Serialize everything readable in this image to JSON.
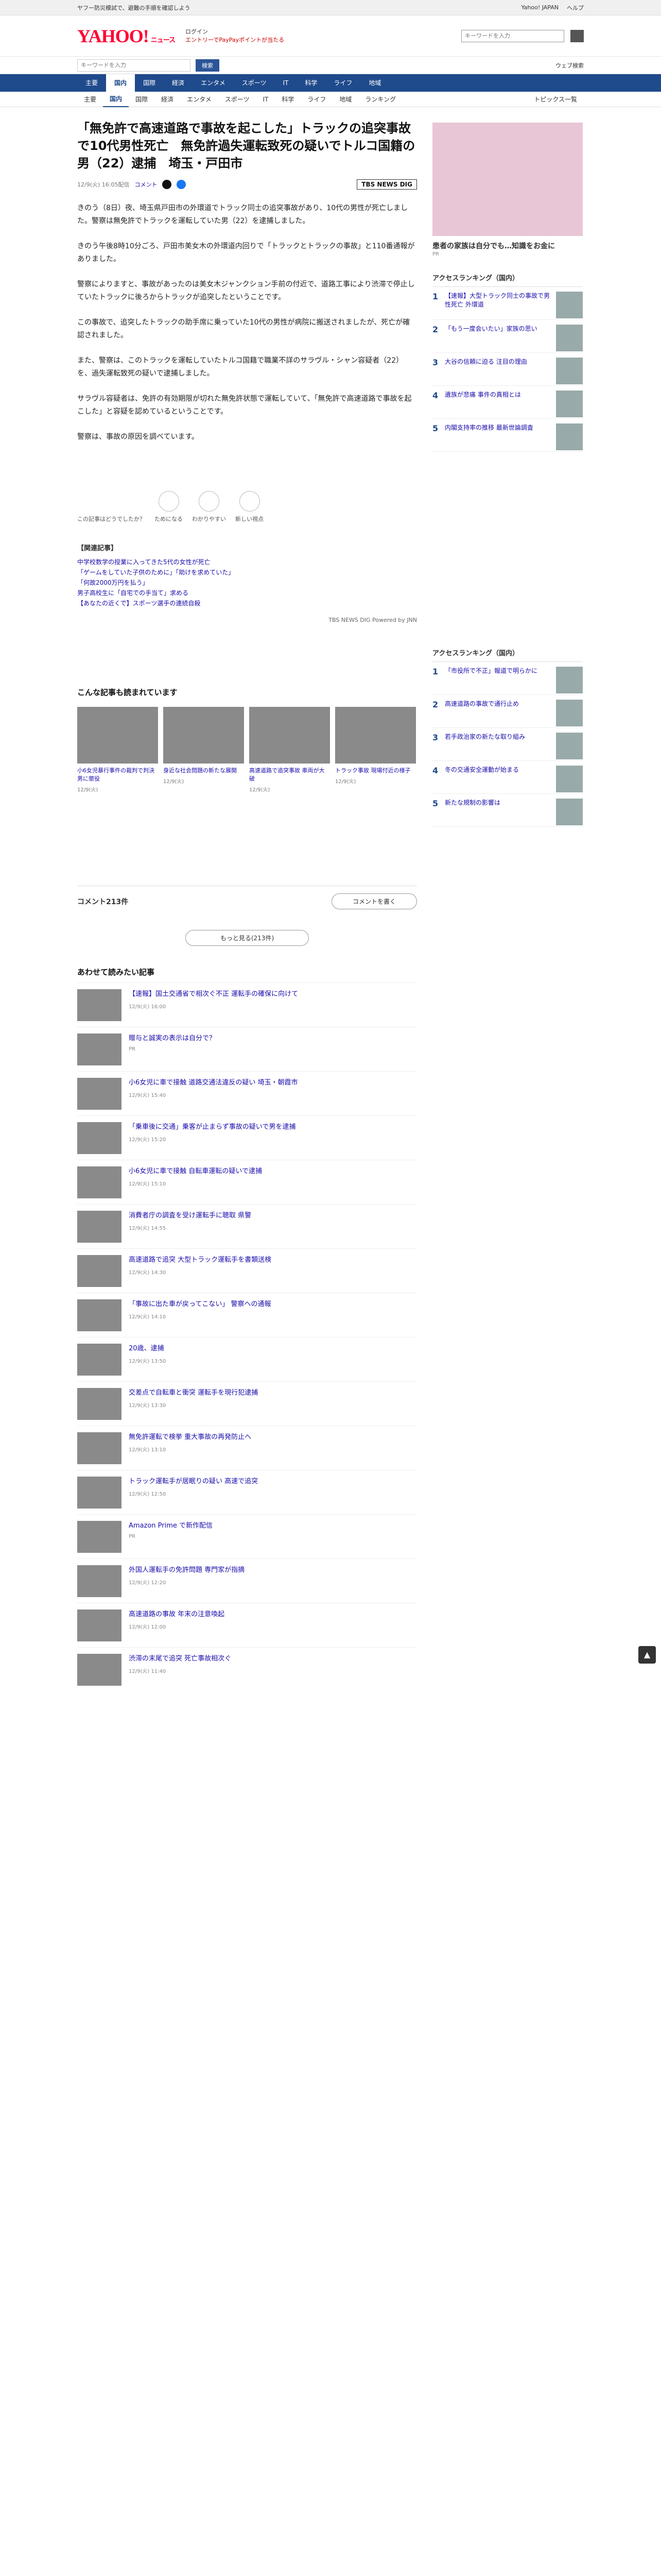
{
  "topbar": {
    "left": "ヤフー防災模試で、避難の手順を確認しよう",
    "mid": "ログイン",
    "links": [
      "Yahoo! JAPAN",
      "ヘルプ"
    ]
  },
  "header": {
    "logo": "YAHOO!",
    "logo_sub": "ニュース",
    "account": "ログイン",
    "promo": "エントリーでPayPayポイントが当たる",
    "search_placeholder": "キーワードを入力"
  },
  "subbar": {
    "search_placeholder": "キーワードを入力",
    "btn1": "検索",
    "btn2": "ウェブ検索"
  },
  "nav": [
    "主要",
    "国内",
    "国際",
    "経済",
    "エンタメ",
    "スポーツ",
    "IT",
    "科学",
    "ライフ",
    "地域"
  ],
  "nav_active": "国内",
  "nav2": [
    "主要",
    "国内",
    "国際",
    "経済",
    "エンタメ",
    "スポーツ",
    "IT",
    "科学",
    "ライフ",
    "地域",
    "ランキング"
  ],
  "nav2_active": "国内",
  "nav2_right": "トピックス一覧",
  "article": {
    "title": "「無免許で高速道路で事故を起こした」トラックの追突事故で10代男性死亡　無免許過失運転致死の疑いでトルコ国籍の男（22）逮捕　埼玉・戸田市",
    "date": "12/9(火) 16:05配信",
    "comments_label": "コメント",
    "source": "TBS NEWS DIG",
    "paragraphs": [
      "きのう（8日）夜、埼玉県戸田市の外環道でトラック同士の追突事故があり、10代の男性が死亡しました。警察は無免許でトラックを運転していた男（22）を逮捕しました。",
      "きのう午後8時10分ごろ、戸田市美女木の外環道内回りで「トラックとトラックの事故」と110番通報がありました。",
      "警察によりますと、事故があったのは美女木ジャンクション手前の付近で、道路工事により渋滞で停止していたトラックに後ろからトラックが追突したということです。",
      "この事故で、追突したトラックの助手席に乗っていた10代の男性が病院に搬送されましたが、死亡が確認されました。",
      "また、警察は、このトラックを運転していたトルコ国籍で職業不詳のサラヴル・シャン容疑者（22）を、過失運転致死の疑いで逮捕しました。",
      "サラヴル容疑者は、免許の有効期限が切れた無免許状態で運転していて、「無免許で高速道路で事故を起こした」と容疑を認めているということです。",
      "警察は、事故の原因を調べています。"
    ],
    "reactions_label": "この記事はどうでしたか？",
    "reactions": [
      "ためになる",
      "わかりやすい",
      "新しい視点"
    ],
    "related_head": "【関連記事】",
    "related": [
      "中学校数学の授業に入ってきた5代の女性が死亡",
      "「ゲームをしていた子供のために」「助けを求めていた」",
      "「何故2000万円を払う」",
      "男子高校生に「自宅での手当て」求める",
      "【あなたの近くで】スポーツ選手の連続自殺"
    ],
    "credit": "TBS NEWS DIG Powered by JNN"
  },
  "read_together": {
    "head": "こんな記事も読まれています",
    "cards": [
      {
        "t": "小6女児暴行事件の裁判で判決 男に懲役",
        "s": "12/9(火)"
      },
      {
        "t": "身近な社会問題の新たな展開",
        "s": "12/9(火)"
      },
      {
        "t": "高速道路で追突事故 車両が大破",
        "s": "12/9(火)"
      },
      {
        "t": "トラック事故 現場付近の様子",
        "s": "12/9(火)"
      }
    ]
  },
  "comments": {
    "count": "コメント213件",
    "btn": "コメントを書く",
    "more": "もっと見る(213件)"
  },
  "list": {
    "head": "あわせて読みたい記事",
    "items": [
      {
        "t": "【速報】国土交通省で相次ぐ不正 運転手の確保に向けて",
        "s": "12/9(火) 16:00"
      },
      {
        "t": "贈与と誠実の表示は自分で？",
        "s": "PR"
      },
      {
        "t": "小6女児に車で接触 道路交通法違反の疑い 埼玉・朝霞市",
        "s": "12/9(火) 15:40"
      },
      {
        "t": "「乗車後に交通」乗客が止まらず事故の疑いで男を逮捕",
        "s": "12/9(火) 15:20"
      },
      {
        "t": "小6女児に車で接触 自転車運転の疑いで逮捕",
        "s": "12/9(火) 15:10"
      },
      {
        "t": "消費者庁の調査を受け運転手に聴取 県警",
        "s": "12/9(火) 14:55"
      },
      {
        "t": "高速道路で追突 大型トラック運転手を書類送検",
        "s": "12/9(火) 14:30"
      },
      {
        "t": "「事故に出た車が戻ってこない」 警察への通報",
        "s": "12/9(火) 14:10"
      },
      {
        "t": "20歳、逮捕",
        "s": "12/9(火) 13:50"
      },
      {
        "t": "交差点で自転車と衝突 運転手を現行犯逮捕",
        "s": "12/9(火) 13:30"
      },
      {
        "t": "無免許運転で検挙 重大事故の再発防止へ",
        "s": "12/9(火) 13:10"
      },
      {
        "t": "トラック運転手が居眠りの疑い 高速で追突",
        "s": "12/9(火) 12:50"
      },
      {
        "t": "Amazon Prime で新作配信",
        "s": "PR"
      },
      {
        "t": "外国人運転手の免許問題 専門家が指摘",
        "s": "12/9(火) 12:20"
      },
      {
        "t": "高速道路の事故 年末の注意喚起",
        "s": "12/9(火) 12:00"
      },
      {
        "t": "渋滞の末尾で追突 死亡事故相次ぐ",
        "s": "12/9(火) 11:40"
      }
    ]
  },
  "side": {
    "ad_title": "患者の家族は自分でも…知識をお金に",
    "ad_src": "PR",
    "rank_head": "アクセスランキング（国内）",
    "rank": [
      {
        "t": "【速報】大型トラック同士の事故で男性死亡 外環道",
        "n": "1"
      },
      {
        "t": "「もう一度会いたい」家族の思い",
        "n": "2"
      },
      {
        "t": "大谷の信頼に迫る 注目の理由",
        "n": "3"
      },
      {
        "t": "遺族が悲痛 事件の真相とは",
        "n": "4"
      },
      {
        "t": "内閣支持率の推移 最新世論調査",
        "n": "5"
      }
    ],
    "rank2_head": "アクセスランキング（国内）",
    "rank2": [
      {
        "t": "「市役所で不正」報道で明らかに",
        "n": "1"
      },
      {
        "t": "高速道路の事故で通行止め",
        "n": "2"
      },
      {
        "t": "若手政治家の新たな取り組み",
        "n": "3"
      },
      {
        "t": "冬の交通安全運動が始まる",
        "n": "4"
      },
      {
        "t": "新たな規制の影響は",
        "n": "5"
      }
    ]
  }
}
